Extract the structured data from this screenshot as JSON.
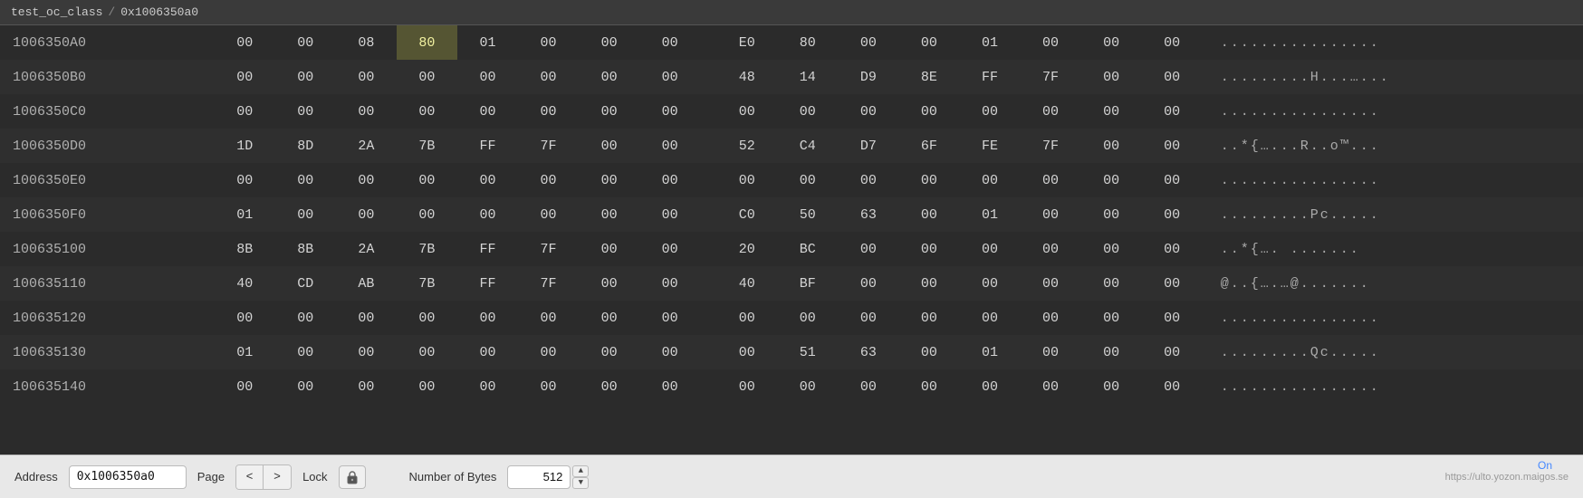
{
  "breadcrumb": {
    "items": [
      "test_oc_class",
      "0x1006350a0"
    ]
  },
  "hex_rows": [
    {
      "address": "1006350A0",
      "bytes": [
        "00",
        "00",
        "08",
        "80",
        "01",
        "00",
        "00",
        "00",
        "E0",
        "80",
        "00",
        "00",
        "01",
        "00",
        "00",
        "00"
      ],
      "highlighted": [
        3
      ],
      "ascii": "................"
    },
    {
      "address": "1006350B0",
      "bytes": [
        "00",
        "00",
        "00",
        "00",
        "00",
        "00",
        "00",
        "00",
        "48",
        "14",
        "D9",
        "8E",
        "FF",
        "7F",
        "00",
        "00"
      ],
      "highlighted": [],
      "ascii": ".........H...…..."
    },
    {
      "address": "1006350C0",
      "bytes": [
        "00",
        "00",
        "00",
        "00",
        "00",
        "00",
        "00",
        "00",
        "00",
        "00",
        "00",
        "00",
        "00",
        "00",
        "00",
        "00"
      ],
      "highlighted": [],
      "ascii": "................"
    },
    {
      "address": "1006350D0",
      "bytes": [
        "1D",
        "8D",
        "2A",
        "7B",
        "FF",
        "7F",
        "00",
        "00",
        "52",
        "C4",
        "D7",
        "6F",
        "FE",
        "7F",
        "00",
        "00"
      ],
      "highlighted": [],
      "ascii": "..*{…...R..o™..."
    },
    {
      "address": "1006350E0",
      "bytes": [
        "00",
        "00",
        "00",
        "00",
        "00",
        "00",
        "00",
        "00",
        "00",
        "00",
        "00",
        "00",
        "00",
        "00",
        "00",
        "00"
      ],
      "highlighted": [],
      "ascii": "................"
    },
    {
      "address": "1006350F0",
      "bytes": [
        "01",
        "00",
        "00",
        "00",
        "00",
        "00",
        "00",
        "00",
        "C0",
        "50",
        "63",
        "00",
        "01",
        "00",
        "00",
        "00"
      ],
      "highlighted": [],
      "ascii": ".........Pc....."
    },
    {
      "address": "100635100",
      "bytes": [
        "8B",
        "8B",
        "2A",
        "7B",
        "FF",
        "7F",
        "00",
        "00",
        "20",
        "BC",
        "00",
        "00",
        "00",
        "00",
        "00",
        "00"
      ],
      "highlighted": [],
      "ascii": "..*{….  ......."
    },
    {
      "address": "100635110",
      "bytes": [
        "40",
        "CD",
        "AB",
        "7B",
        "FF",
        "7F",
        "00",
        "00",
        "40",
        "BF",
        "00",
        "00",
        "00",
        "00",
        "00",
        "00"
      ],
      "highlighted": [],
      "ascii": "@..{….…@......."
    },
    {
      "address": "100635120",
      "bytes": [
        "00",
        "00",
        "00",
        "00",
        "00",
        "00",
        "00",
        "00",
        "00",
        "00",
        "00",
        "00",
        "00",
        "00",
        "00",
        "00"
      ],
      "highlighted": [],
      "ascii": "................"
    },
    {
      "address": "100635130",
      "bytes": [
        "01",
        "00",
        "00",
        "00",
        "00",
        "00",
        "00",
        "00",
        "00",
        "51",
        "63",
        "00",
        "01",
        "00",
        "00",
        "00"
      ],
      "highlighted": [],
      "ascii": ".........Qc....."
    },
    {
      "address": "100635140",
      "bytes": [
        "00",
        "00",
        "00",
        "00",
        "00",
        "00",
        "00",
        "00",
        "00",
        "00",
        "00",
        "00",
        "00",
        "00",
        "00",
        "00"
      ],
      "highlighted": [],
      "ascii": "................"
    }
  ],
  "toolbar": {
    "address_label": "Address",
    "address_value": "0x1006350a0",
    "page_label": "Page",
    "prev_label": "<",
    "next_label": ">",
    "lock_label": "Lock",
    "bytes_label": "Number of Bytes",
    "bytes_value": "512",
    "on_text": "On"
  }
}
